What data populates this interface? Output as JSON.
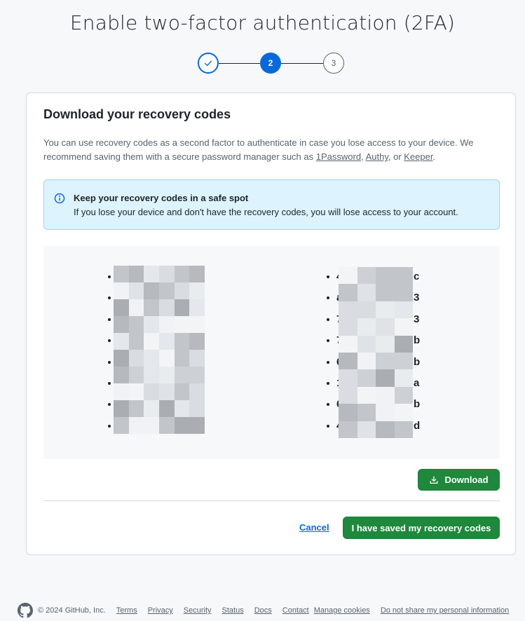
{
  "page": {
    "title": "Enable two-factor authentication (2FA)"
  },
  "stepper": {
    "steps": [
      {
        "label": "",
        "state": "complete",
        "icon": "check-icon"
      },
      {
        "label": "2",
        "state": "current"
      },
      {
        "label": "3",
        "state": "upcoming"
      }
    ]
  },
  "card": {
    "title": "Download your recovery codes",
    "intro_text": "You can use recovery codes as a second factor to authenticate in case you lose access to your device. We recommend saving them with a secure password manager such as ",
    "links": [
      "1Password",
      "Authy",
      "Keeper"
    ],
    "sep1": ", ",
    "sep2": ", or ",
    "end": ".",
    "flash": {
      "icon": "info-icon",
      "title": "Keep your recovery codes in a safe spot",
      "body": "If you lose your device and don't have the recovery codes, you will lose access to your account."
    },
    "codes": {
      "left": [
        "",
        "",
        "",
        "",
        "",
        "",
        "",
        ""
      ],
      "right": [
        "4",
        "a",
        "7",
        "7",
        "6",
        "1",
        "6",
        "4"
      ],
      "right_tail": [
        "c",
        "3",
        "3",
        "b",
        "b",
        "a",
        "b",
        "d"
      ]
    },
    "download_button": {
      "label": "Download",
      "icon": "download-icon"
    },
    "cancel_label": "Cancel",
    "saved_button": {
      "label": "I have saved my recovery codes"
    }
  },
  "footer": {
    "logo_icon": "github-mark-icon",
    "copyright": "© 2024 GitHub, Inc.",
    "links": [
      "Terms",
      "Privacy",
      "Security",
      "Status",
      "Docs",
      "Contact",
      "Manage cookies",
      "Do not share my personal information"
    ]
  },
  "colors": {
    "primary_blue": "#0969da",
    "primary_green": "#1f883d",
    "flash_bg": "#ddf4ff",
    "page_bg": "#f6f8fa"
  }
}
